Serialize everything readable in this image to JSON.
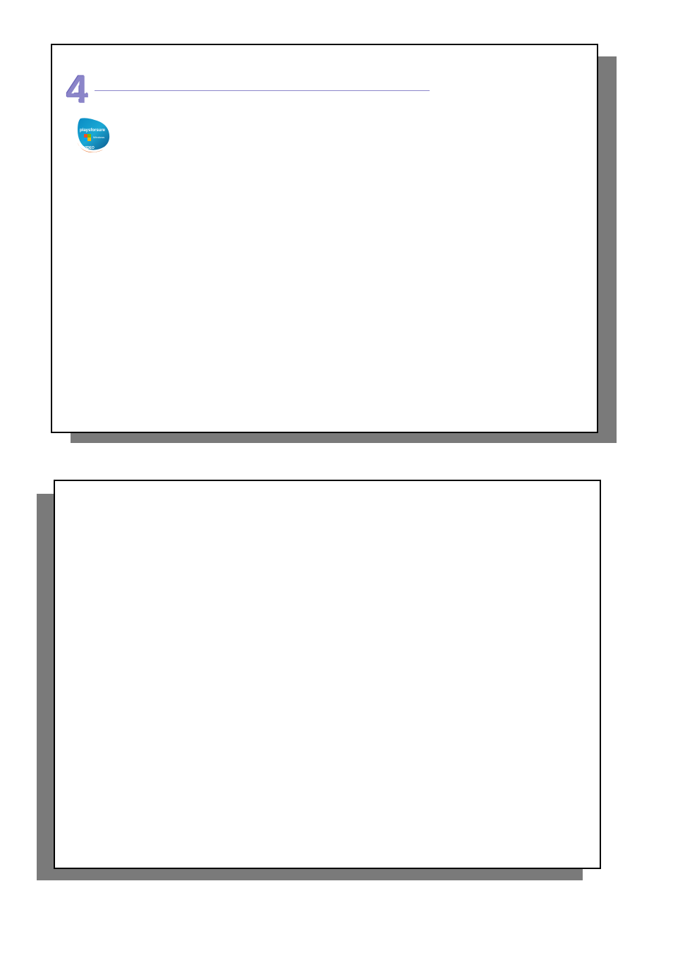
{
  "chapter": {
    "number": "4"
  },
  "logo": {
    "name": "playsforsure-logo",
    "text_main": "playsforsure",
    "text_sub": "Windows",
    "text_bottom": "VIDEO"
  }
}
